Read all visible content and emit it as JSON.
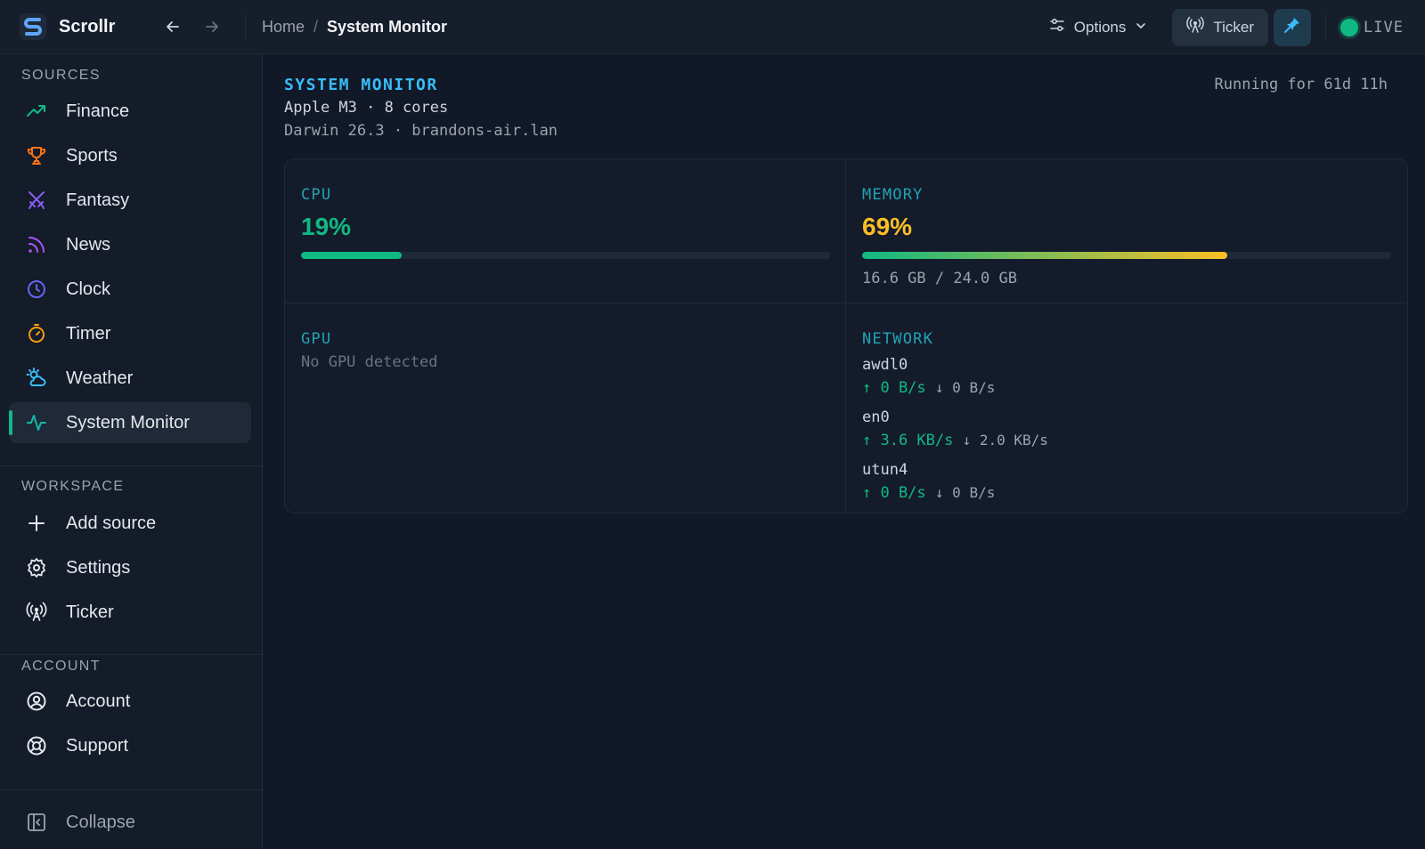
{
  "app": {
    "name": "Scrollr",
    "breadcrumb_home": "Home",
    "breadcrumb_sep": "/",
    "breadcrumb_current": "System Monitor",
    "options_label": "Options",
    "ticker_label": "Ticker",
    "live_label": "LIVE"
  },
  "sidebar": {
    "sources_label": "SOURCES",
    "sources": [
      {
        "label": "Finance",
        "icon": "trending-up-icon"
      },
      {
        "label": "Sports",
        "icon": "trophy-icon"
      },
      {
        "label": "Fantasy",
        "icon": "swords-icon"
      },
      {
        "label": "News",
        "icon": "rss-icon"
      },
      {
        "label": "Clock",
        "icon": "clock-icon"
      },
      {
        "label": "Timer",
        "icon": "timer-icon"
      },
      {
        "label": "Weather",
        "icon": "weather-icon"
      },
      {
        "label": "System Monitor",
        "icon": "activity-icon"
      }
    ],
    "workspace_label": "WORKSPACE",
    "workspace": [
      {
        "label": "Add source",
        "icon": "plus-icon"
      },
      {
        "label": "Settings",
        "icon": "gear-icon"
      },
      {
        "label": "Ticker",
        "icon": "broadcast-icon"
      }
    ],
    "account_label": "ACCOUNT",
    "account": [
      {
        "label": "Account",
        "icon": "user-circle-icon"
      },
      {
        "label": "Support",
        "icon": "lifebuoy-icon"
      }
    ],
    "collapse_label": "Collapse"
  },
  "monitor": {
    "title": "SYSTEM MONITOR",
    "cpu_info": "Apple M3 · 8 cores",
    "os_info": "Darwin 26.3 · brandons-air.lan",
    "uptime": "Running for 61d 11h",
    "cpu": {
      "label": "CPU",
      "percent": "19%",
      "value": 0.19
    },
    "memory": {
      "label": "MEMORY",
      "percent": "69%",
      "value": 0.69,
      "detail": "16.6 GB / 24.0 GB"
    },
    "gpu": {
      "label": "GPU",
      "text": "No GPU detected"
    },
    "network": {
      "label": "NETWORK",
      "interfaces": [
        {
          "name": "awdl0",
          "up": "↑ 0 B/s",
          "down": "↓ 0 B/s"
        },
        {
          "name": "en0",
          "up": "↑ 3.6 KB/s",
          "down": "↓ 2.0 KB/s"
        },
        {
          "name": "utun4",
          "up": "↑ 0 B/s",
          "down": "↓ 0 B/s"
        }
      ]
    }
  },
  "colors": {
    "accent": "#38bdf8",
    "cpu": "#10b981",
    "memory": "#fbbf24",
    "live": "#10b981"
  }
}
